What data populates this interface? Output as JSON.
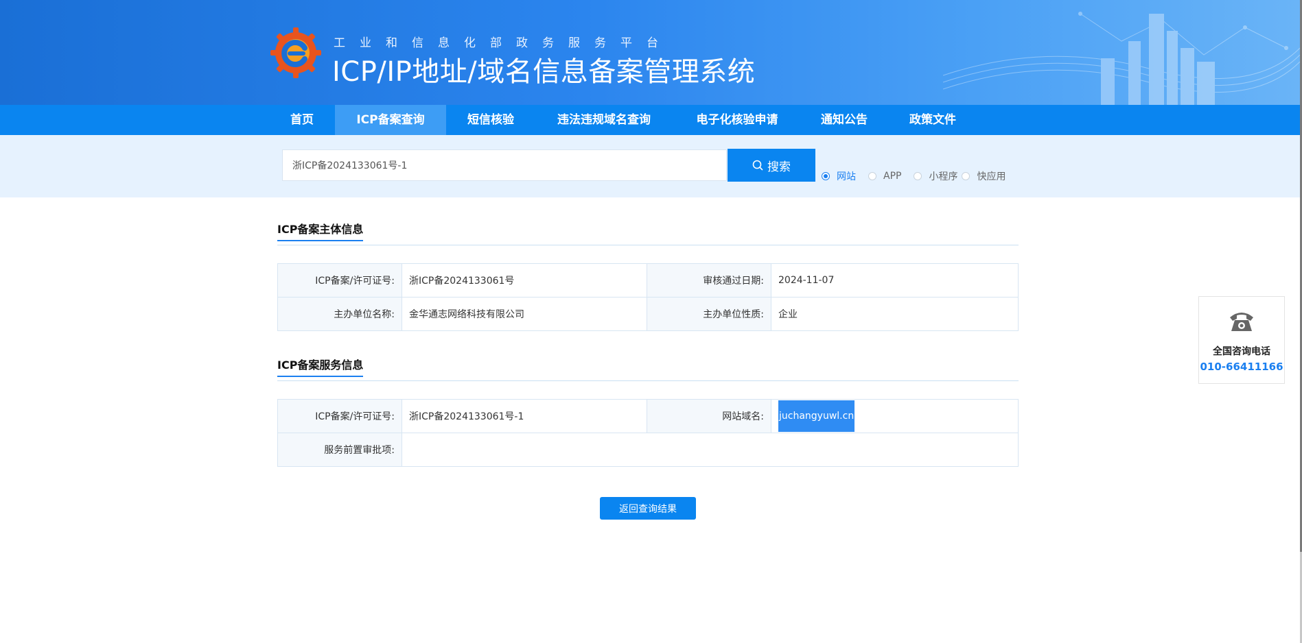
{
  "header": {
    "subtitle": "工业和信息化部政务服务平台",
    "title": "ICP/IP地址/域名信息备案管理系统"
  },
  "nav": [
    {
      "label": "首页",
      "active": false
    },
    {
      "label": "ICP备案查询",
      "active": true
    },
    {
      "label": "短信核验",
      "active": false
    },
    {
      "label": "违法违规域名查询",
      "active": false
    },
    {
      "label": "电子化核验申请",
      "active": false
    },
    {
      "label": "通知公告",
      "active": false
    },
    {
      "label": "政策文件",
      "active": false
    }
  ],
  "search": {
    "value": "浙ICP备2024133061号-1",
    "button_label": "搜索",
    "options": [
      {
        "label": "网站",
        "checked": true
      },
      {
        "label": "APP",
        "checked": false
      },
      {
        "label": "小程序",
        "checked": false
      },
      {
        "label": "快应用",
        "checked": false
      }
    ]
  },
  "subject": {
    "heading": "ICP备案主体信息",
    "license_label": "ICP备案/许可证号:",
    "license_value": "浙ICP备2024133061号",
    "approve_label": "审核通过日期:",
    "approve_value": "2024-11-07",
    "org_name_label": "主办单位名称:",
    "org_name_value": "金华通志网络科技有限公司",
    "org_type_label": "主办单位性质:",
    "org_type_value": "企业"
  },
  "service": {
    "heading": "ICP备案服务信息",
    "license_label": "ICP备案/许可证号:",
    "license_value": "浙ICP备2024133061号-1",
    "domain_label": "网站域名:",
    "domain_value": "juchangyuwl.cn",
    "preapproval_label": "服务前置审批项:",
    "preapproval_value": ""
  },
  "return_label": "返回查询结果",
  "contact": {
    "label": "全国咨询电话",
    "number": "010-66411166"
  },
  "colors": {
    "primary": "#0a85f0",
    "header_blue": "#1a6fd6",
    "search_band": "#e6f2fe",
    "highlight": "#2f8cf3"
  }
}
